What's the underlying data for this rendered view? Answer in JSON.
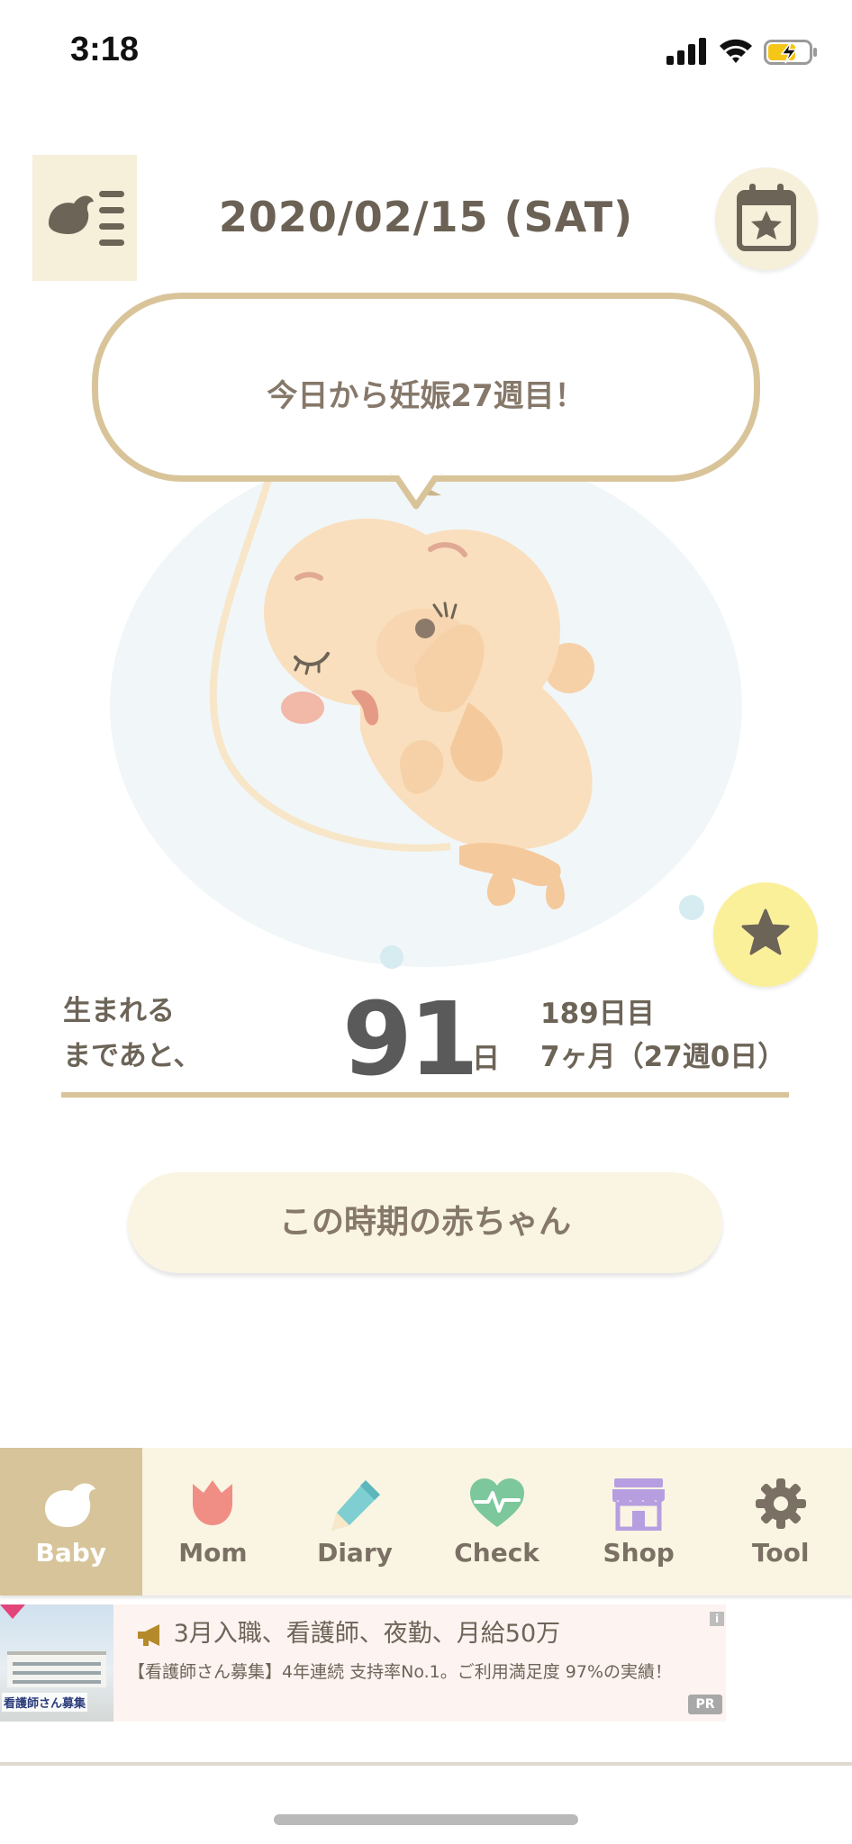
{
  "status_bar": {
    "time": "3:18"
  },
  "header": {
    "date": "2020/02/15 (SAT)",
    "menu_icon": "bird-list-icon",
    "calendar_icon": "calendar-star-icon"
  },
  "main": {
    "speech": "今日から妊娠27週目！",
    "countdown_label_line1": "生まれる",
    "countdown_label_line2": "まであと、",
    "days_remaining": "91",
    "days_unit": "日",
    "day_count": "189日目",
    "month_week": "7ヶ月（27週0日）",
    "baby_info_button": "この時期の赤ちゃん",
    "favorite_icon": "star-icon"
  },
  "tabs": [
    {
      "label": "Baby",
      "icon": "bird-icon",
      "active": true
    },
    {
      "label": "Mom",
      "icon": "tulip-icon",
      "active": false
    },
    {
      "label": "Diary",
      "icon": "pencil-icon",
      "active": false
    },
    {
      "label": "Check",
      "icon": "heart-pulse-icon",
      "active": false
    },
    {
      "label": "Shop",
      "icon": "store-icon",
      "active": false
    },
    {
      "label": "Tool",
      "icon": "gear-icon",
      "active": false
    }
  ],
  "ad": {
    "headline": "3月入職、看護師、夜勤、月給50万",
    "body": "【看護師さん募集】4年連続 支持率No.1。ご利用満足度 97%の実績！",
    "image_text": "看護師さん募集",
    "badge": "PR",
    "info": "i"
  },
  "colors": {
    "accent_beige": "#d7c49a",
    "tab_bg": "#faf5e3",
    "star_yellow": "#fbf09a",
    "text_brown": "#6d6458"
  }
}
